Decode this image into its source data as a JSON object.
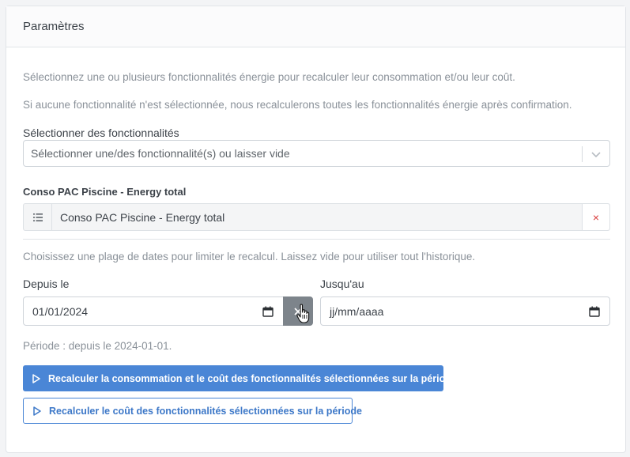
{
  "card": {
    "title": "Paramètres"
  },
  "intro": {
    "line1": "Sélectionnez une ou plusieurs fonctionnalités énergie pour recalculer leur consommation et/ou leur coût.",
    "line2": "Si aucune fonctionnalité n'est sélectionnée, nous recalculerons toutes les fonctionnalités énergie après confirmation."
  },
  "features": {
    "label": "Sélectionner des fonctionnalités",
    "placeholder": "Sélectionner une/des fonctionnalité(s) ou laisser vide",
    "selected_heading": "Conso PAC Piscine - Energy total",
    "selected_items": [
      {
        "name": "Conso PAC Piscine - Energy total",
        "remove": "×"
      }
    ]
  },
  "dates": {
    "help": "Choisissez une plage de dates pour limiter le recalcul. Laissez vide pour utiliser tout l'historique.",
    "from_label": "Depuis le",
    "from_value": "01/01/2024",
    "to_label": "Jusqu'au",
    "to_value": "jj/mm/aaaa",
    "period_text": "Période : depuis le 2024-01-01."
  },
  "actions": {
    "recalc_all": "Recalculer la consommation et le coût des fonctionnalités sélectionnées sur la période",
    "recalc_cost": "Recalculer le coût des fonctionnalités sélectionnées sur la période"
  },
  "icons": {
    "chevron": "chevron-down-icon",
    "list": "list-icon",
    "calendar": "calendar-icon",
    "clear": "close-icon",
    "play": "play-icon",
    "cursor": "hand-pointer-icon"
  },
  "colors": {
    "primary": "#4a86d6",
    "danger": "#d93b3b",
    "clear_button": "#7d848b"
  }
}
